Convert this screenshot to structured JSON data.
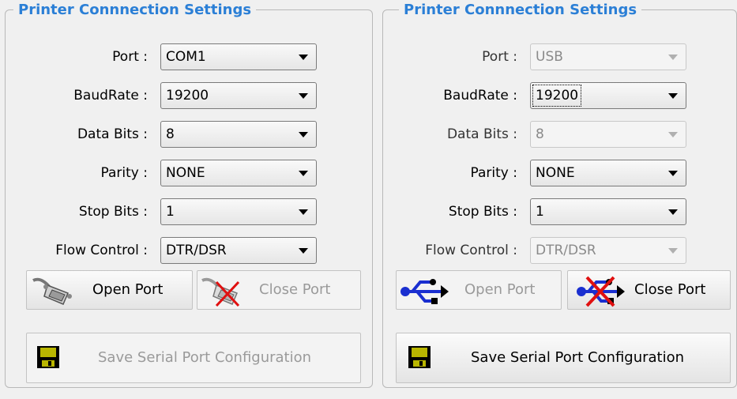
{
  "panels": [
    {
      "title": "Printer Connnection Settings",
      "fields": [
        {
          "label": "Port :",
          "value": "COM1",
          "enabled": true
        },
        {
          "label": "BaudRate :",
          "value": "19200",
          "enabled": true
        },
        {
          "label": "Data Bits :",
          "value": "8",
          "enabled": true
        },
        {
          "label": "Parity :",
          "value": "NONE",
          "enabled": true
        },
        {
          "label": "Stop Bits :",
          "value": "1",
          "enabled": true
        },
        {
          "label": "Flow Control :",
          "value": "DTR/DSR",
          "enabled": true
        }
      ],
      "open_port": {
        "label": "Open Port",
        "icon": "serial-cable-icon",
        "enabled": true
      },
      "close_port": {
        "label": "Close Port",
        "icon": "serial-cable-disconnect-icon",
        "enabled": false
      },
      "save": {
        "label": "Save Serial Port Configuration",
        "icon": "floppy-disk-icon",
        "enabled": false
      }
    },
    {
      "title": "Printer Connnection Settings",
      "fields": [
        {
          "label": "Port :",
          "value": "USB",
          "enabled": false
        },
        {
          "label": "BaudRate :",
          "value": "19200",
          "enabled": true
        },
        {
          "label": "Data Bits :",
          "value": "8",
          "enabled": false
        },
        {
          "label": "Parity :",
          "value": "NONE",
          "enabled": true
        },
        {
          "label": "Stop Bits :",
          "value": "1",
          "enabled": true
        },
        {
          "label": "Flow Control :",
          "value": "DTR/DSR",
          "enabled": false
        }
      ],
      "open_port": {
        "label": "Open Port",
        "icon": "usb-icon",
        "enabled": false
      },
      "close_port": {
        "label": "Close Port",
        "icon": "usb-disconnect-icon",
        "enabled": true
      },
      "save": {
        "label": "Save Serial Port Configuration",
        "icon": "floppy-disk-icon",
        "enabled": true
      }
    }
  ],
  "colors": {
    "legend": "#2b7fd6",
    "disabled_text": "#9a9a9a",
    "usb_blue": "#1a2fd0",
    "cross_red": "#e01010"
  }
}
